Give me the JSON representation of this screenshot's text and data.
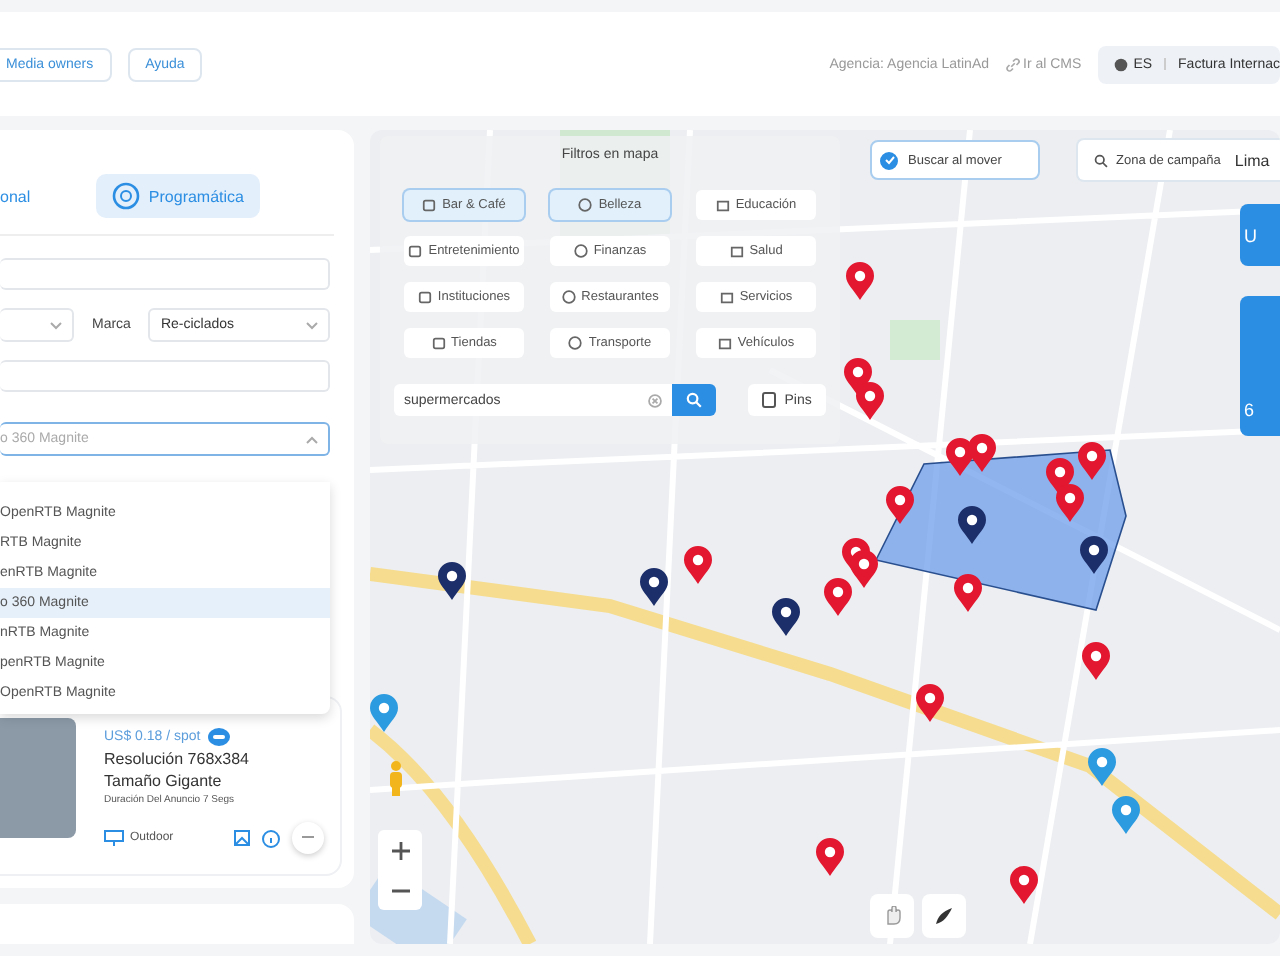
{
  "header": {
    "buttons": [
      {
        "label": "Media owners"
      },
      {
        "label": "Ayuda"
      }
    ],
    "agency": "Agencia: Agencia LatinAd",
    "cms_link": "Ir al CMS",
    "language": "ES",
    "invoice": "Factura Internac"
  },
  "left_panel": {
    "tabs": [
      {
        "label": "onal",
        "selected": false
      },
      {
        "label": "Programática",
        "selected": true
      }
    ],
    "fields": [
      {
        "kind": "input"
      },
      {
        "kind": "select_pair",
        "label": "Marca",
        "value": "Re-ciclados"
      },
      {
        "kind": "input"
      },
      {
        "kind": "select",
        "placeholder": "o 360 Magnite"
      }
    ],
    "dropdown": [
      {
        "label": "OpenRTB Magnite",
        "selected": false
      },
      {
        "label": "RTB Magnite",
        "selected": false
      },
      {
        "label": "enRTB Magnite",
        "selected": false
      },
      {
        "label": "o 360 Magnite",
        "selected": true
      },
      {
        "label": "nRTB Magnite",
        "selected": false
      },
      {
        "label": "penRTB Magnite",
        "selected": false
      },
      {
        "label": "OpenRTB Magnite",
        "selected": false
      }
    ],
    "card": {
      "price": "US$ 0.18 / spot",
      "resolution": "Resolución 768x384",
      "size": "Tamaño Gigante",
      "duration": "Duración Del Anuncio 7 Segs",
      "category": "Outdoor"
    }
  },
  "map": {
    "filters_title": "Filtros en mapa",
    "filters": [
      {
        "label": "Bar & Café",
        "selected": true
      },
      {
        "label": "Belleza",
        "selected": true
      },
      {
        "label": "Educación",
        "selected": false
      },
      {
        "label": "Entretenimiento",
        "selected": false
      },
      {
        "label": "Finanzas",
        "selected": false
      },
      {
        "label": "Salud",
        "selected": false
      },
      {
        "label": "Instituciones",
        "selected": false
      },
      {
        "label": "Restaurantes",
        "selected": false
      },
      {
        "label": "Servicios",
        "selected": false
      },
      {
        "label": "Tiendas",
        "selected": false
      },
      {
        "label": "Transporte",
        "selected": false
      },
      {
        "label": "Vehículos",
        "selected": false
      }
    ],
    "search": {
      "value": "supermercados"
    },
    "pins_button": "Pins",
    "search_on_move": {
      "label": "Buscar al mover",
      "checked": true
    },
    "zone": {
      "label": "Zona de campaña",
      "value": "Lima"
    },
    "side_buttons": [
      {
        "label": "U"
      },
      {
        "label": "6"
      }
    ],
    "pins": [
      {
        "color": "#e3172f"
      },
      {
        "color": "#e3172f"
      },
      {
        "color": "#e3172f"
      },
      {
        "color": "#e3172f"
      },
      {
        "color": "#e3172f"
      },
      {
        "color": "#e3172f"
      },
      {
        "color": "#e3172f"
      },
      {
        "color": "#e3172f"
      },
      {
        "color": "#e3172f"
      },
      {
        "color": "#e3172f"
      },
      {
        "color": "#e3172f"
      },
      {
        "color": "#e3172f"
      },
      {
        "color": "#e3172f"
      },
      {
        "color": "#e3172f"
      },
      {
        "color": "#e3172f"
      },
      {
        "color": "#e3172f"
      },
      {
        "color": "#e3172f"
      },
      {
        "color": "#e3172f"
      },
      {
        "color": "#1d2f6b"
      },
      {
        "color": "#1d2f6b"
      },
      {
        "color": "#1d2f6b"
      },
      {
        "color": "#1d2f6b"
      },
      {
        "color": "#1d2f6b"
      },
      {
        "color": "#2d9be0"
      },
      {
        "color": "#2d9be0"
      },
      {
        "color": "#2d9be0"
      }
    ]
  }
}
